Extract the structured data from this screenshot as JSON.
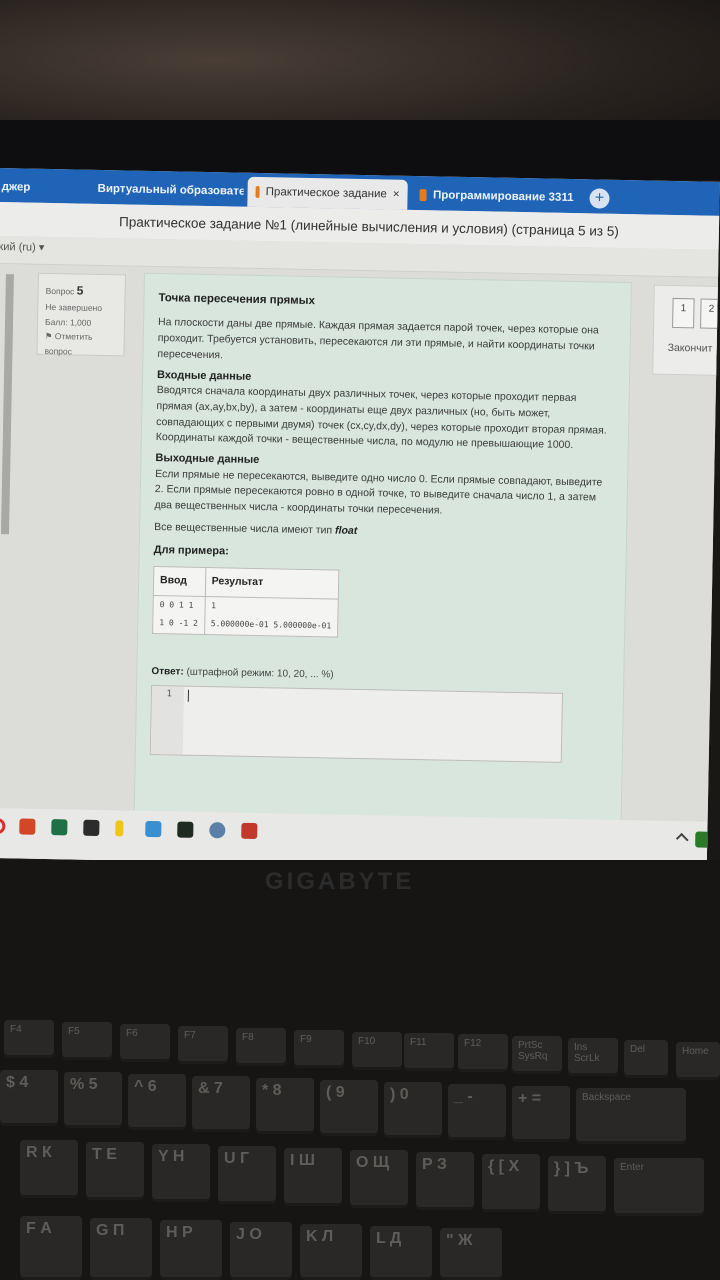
{
  "tabs": [
    {
      "label": "джер",
      "active": false
    },
    {
      "label": "Виртуальный образовате",
      "active": false
    },
    {
      "label": "Практическое задание",
      "active": true
    },
    {
      "label": "Программирование 3311",
      "active": false
    }
  ],
  "tab_close_glyph": "×",
  "tab_add_glyph": "+",
  "page_title": "Практическое задание №1 (линейные вычисления и условия) (страница 5 из 5)",
  "language_selector": "кий (ru) ▾",
  "question_info": {
    "label": "Вопрос",
    "number": "5",
    "status": "Не завершено",
    "score": "Балл: 1,000",
    "flag": "Отметить вопрос"
  },
  "question": {
    "title": "Точка пересечения прямых",
    "intro": "На плоскости даны две прямые. Каждая прямая задается парой точек, через которые она проходит. Требуется установить, пересекаются ли эти прямые, и найти координаты точки пересечения.",
    "input_heading": "Входные данные",
    "input_text": "Вводятся сначала координаты двух различных точек, через которые проходит первая прямая (ax,ay,bx,by), а затем - координаты еще двух различных (но, быть может, совпадающих с первыми двумя) точек (cx,cy,dx,dy), через которые проходит вторая прямая. Координаты каждой точки - вещественные числа, по модулю не превышающие 1000.",
    "output_heading": "Выходные данные",
    "output_text": "Если прямые не пересекаются, выведите одно число 0. Если прямые совпадают, выведите 2. Если прямые пересекаются ровно в одной точке, то выведите сначала число 1, а затем два вещественных числа - координаты точки пересечения.",
    "note_prefix": "Все вещественные числа имеют тип",
    "note_type": "float",
    "example_title": "Для примера:",
    "table_headers": [
      "Ввод",
      "Результат"
    ],
    "table_rows": [
      [
        "0 0 1 1",
        "1"
      ],
      [
        "1 0 -1 2",
        "5.000000e-01 5.000000e-01"
      ]
    ],
    "answer_label": "Ответ:",
    "answer_mode": "(штрафной режим: 10, 20, ... %)",
    "editor_line": "1"
  },
  "nav": {
    "buttons": [
      "1",
      "2"
    ],
    "finish": "Закончит"
  },
  "keyboard": {
    "brand": "GIGABYTE",
    "fn_row": [
      "F4",
      "F5",
      "F6",
      "F7",
      "F8",
      "F9",
      "F10",
      "F11",
      "F12",
      "PrtSc SysRq",
      "Ins ScrLk",
      "Del",
      "Home"
    ],
    "num_row": [
      "$ 4",
      "% 5",
      "^ 6",
      "& 7",
      "* 8",
      "( 9",
      ") 0",
      "_ -",
      "+ =",
      "Backspace"
    ],
    "top_row": [
      "R К",
      "T Е",
      "Y Н",
      "U Г",
      "I Ш",
      "O Щ",
      "P З",
      "{ [ Х",
      "} ] Ъ",
      "Enter"
    ],
    "home_row": [
      "F А",
      "G П",
      "H Р",
      "J О",
      "K Л",
      "L Д",
      "\" Ж"
    ]
  }
}
